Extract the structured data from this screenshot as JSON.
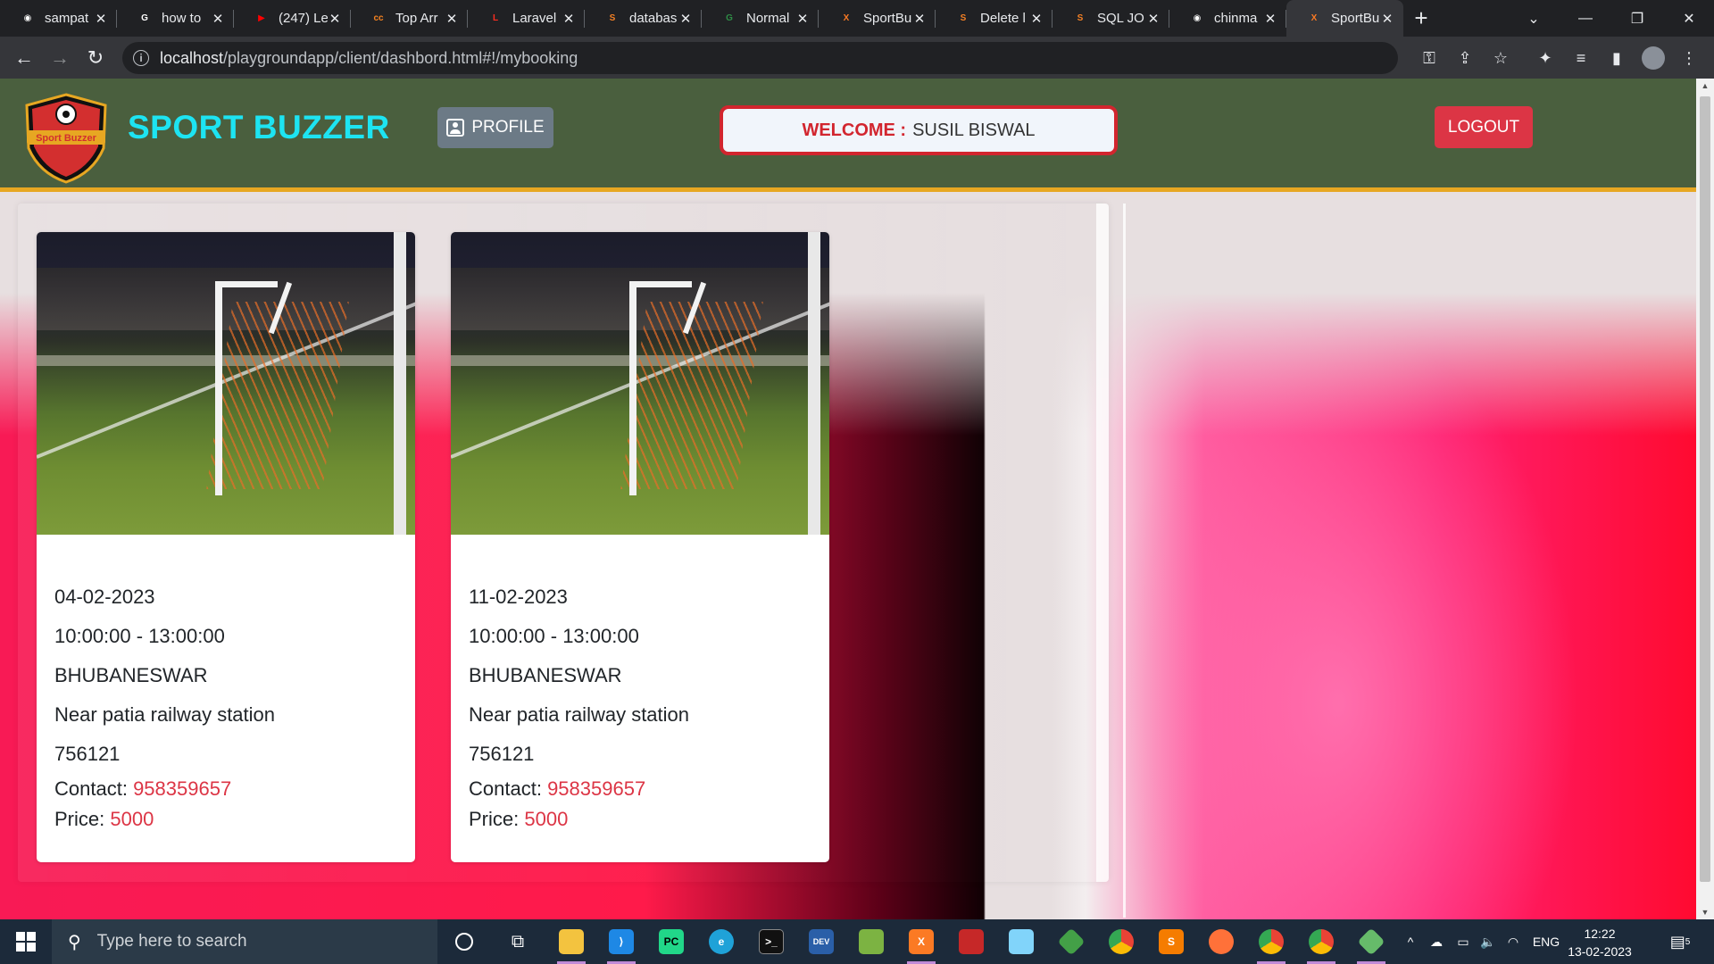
{
  "browser": {
    "tabs": [
      {
        "title": "sampat",
        "favicon": "github-icon",
        "color": "#ffffff",
        "glyph": "◉"
      },
      {
        "title": "how to",
        "favicon": "google-icon",
        "color": "#ffffff",
        "glyph": "G"
      },
      {
        "title": "(247) Le",
        "favicon": "youtube-icon",
        "color": "#ff0000",
        "glyph": "▶"
      },
      {
        "title": "Top Arr",
        "favicon": "codesite-icon",
        "color": "#f58220",
        "glyph": "cc"
      },
      {
        "title": "Laravel",
        "favicon": "laravel-icon",
        "color": "#ff2d20",
        "glyph": "L"
      },
      {
        "title": "databas",
        "favicon": "stackoverflow-icon",
        "color": "#f48024",
        "glyph": "S"
      },
      {
        "title": "Normal",
        "favicon": "gfg-icon",
        "color": "#2f8d46",
        "glyph": "G"
      },
      {
        "title": "SportBu",
        "favicon": "xampp-icon",
        "color": "#fb7a24",
        "glyph": "X"
      },
      {
        "title": "Delete l",
        "favicon": "stackoverflow-icon",
        "color": "#f48024",
        "glyph": "S"
      },
      {
        "title": "SQL JO",
        "favicon": "stackoverflow-icon",
        "color": "#f48024",
        "glyph": "S"
      },
      {
        "title": "chinma",
        "favicon": "github-icon",
        "color": "#ffffff",
        "glyph": "◉"
      },
      {
        "title": "SportBu",
        "favicon": "xampp-icon",
        "color": "#fb7a24",
        "glyph": "X",
        "active": true
      }
    ],
    "url_host": "localhost",
    "url_path": "/playgroundapp/client/dashbord.html#!/mybooking"
  },
  "header": {
    "brand": "SPORT BUZZER",
    "logo_text": "Sport Buzzer",
    "profile_label": "PROFILE",
    "welcome_label": "WELCOME :",
    "welcome_name": "SUSIL BISWAL",
    "logout_label": "LOGOUT",
    "colors": {
      "header_bg": "#4a5f3e",
      "accent": "#e7a722",
      "brand": "#1de4f2",
      "danger": "#dc3545"
    }
  },
  "bookings": [
    {
      "date": "04-02-2023",
      "time": "10:00:00 - 13:00:00",
      "city": "BHUBANESWAR",
      "address": "Near patia railway station",
      "pincode": "756121",
      "contact_label": "Contact:",
      "contact": "958359657",
      "price_label": "Price:",
      "price": "5000"
    },
    {
      "date": "11-02-2023",
      "time": "10:00:00 - 13:00:00",
      "city": "BHUBANESWAR",
      "address": "Near patia railway station",
      "pincode": "756121",
      "contact_label": "Contact:",
      "contact": "958359657",
      "price_label": "Price:",
      "price": "5000"
    }
  ],
  "taskbar": {
    "search_placeholder": "Type here to search",
    "language": "ENG",
    "time": "12:22",
    "date": "13-02-2023",
    "notification_count": "5"
  }
}
